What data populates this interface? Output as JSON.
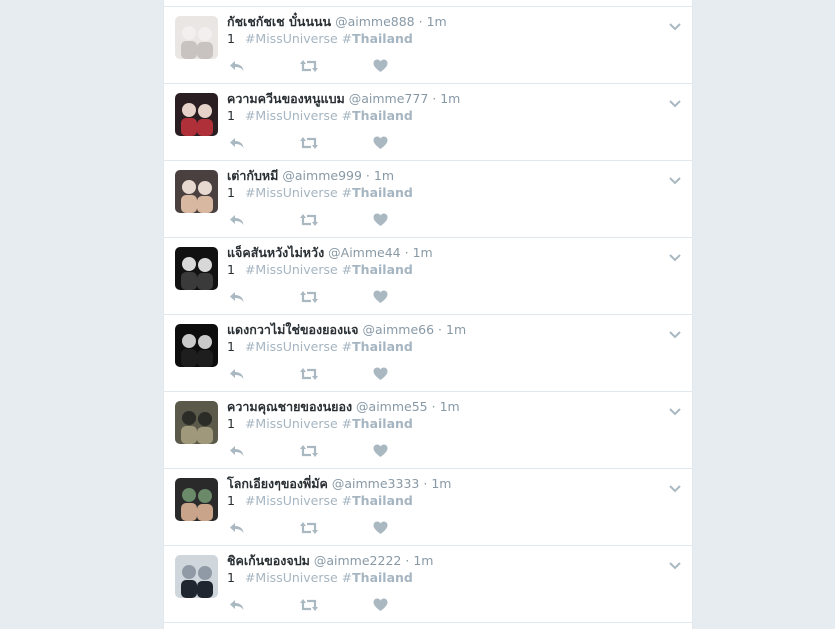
{
  "colors": {
    "page_background": "#e6ecf0",
    "card_background": "#ffffff",
    "hashtag": "#a5b5c1",
    "muted": "#8899a6",
    "action_icon": "#aab8c2",
    "text": "#292f33"
  },
  "tweets": [
    {
      "name": "กัชเชกัชเช บั๋นนนน",
      "handle": "@aimme888",
      "sep": "·",
      "time": "1m",
      "number": "1",
      "tags": [
        {
          "hash": "#",
          "word": "MissUniverse"
        },
        {
          "hash": "#",
          "word": "Thailand"
        }
      ],
      "avatar_colors": [
        "#e9e6e4",
        "#c8c2c0",
        "#f2efee"
      ]
    },
    {
      "name": "ความควีนของหนูแบม",
      "handle": "@aimme777",
      "sep": "·",
      "time": "1m",
      "number": "1",
      "tags": [
        {
          "hash": "#",
          "word": "MissUniverse"
        },
        {
          "hash": "#",
          "word": "Thailand"
        }
      ],
      "avatar_colors": [
        "#2a1e22",
        "#b0303a",
        "#e6d2c8"
      ]
    },
    {
      "name": "เต่ากับหมี",
      "handle": "@aimme999",
      "sep": "·",
      "time": "1m",
      "number": "1",
      "tags": [
        {
          "hash": "#",
          "word": "MissUniverse"
        },
        {
          "hash": "#",
          "word": "Thailand"
        }
      ],
      "avatar_colors": [
        "#4a4040",
        "#d9b8a2",
        "#e8d9d0"
      ]
    },
    {
      "name": "แจ็คสันหวังไม่หวัง",
      "handle": "@Aimme44",
      "sep": "·",
      "time": "1m",
      "number": "1",
      "tags": [
        {
          "hash": "#",
          "word": "MissUniverse"
        },
        {
          "hash": "#",
          "word": "Thailand"
        }
      ],
      "avatar_colors": [
        "#111111",
        "#3a3a3a",
        "#d8d8d8"
      ]
    },
    {
      "name": "แดงกวาไม่ใช่ของยองแจ",
      "handle": "@aimme66",
      "sep": "·",
      "time": "1m",
      "number": "1",
      "tags": [
        {
          "hash": "#",
          "word": "MissUniverse"
        },
        {
          "hash": "#",
          "word": "Thailand"
        }
      ],
      "avatar_colors": [
        "#0d0d0d",
        "#1e1e1e",
        "#c9c9c9"
      ]
    },
    {
      "name": "ความคุณชายของนยอง",
      "handle": "@aimme55",
      "sep": "·",
      "time": "1m",
      "number": "1",
      "tags": [
        {
          "hash": "#",
          "word": "MissUniverse"
        },
        {
          "hash": "#",
          "word": "Thailand"
        }
      ],
      "avatar_colors": [
        "#5b5a4a",
        "#a0987a",
        "#2b2b28"
      ]
    },
    {
      "name": "โลกเอียงๆของพี่มัค",
      "handle": "@aimme3333",
      "sep": "·",
      "time": "1m",
      "number": "1",
      "tags": [
        {
          "hash": "#",
          "word": "MissUniverse"
        },
        {
          "hash": "#",
          "word": "Thailand"
        }
      ],
      "avatar_colors": [
        "#2a2a2a",
        "#c9a48a",
        "#6a8a6a"
      ]
    },
    {
      "name": "ชิคเก้นของจปม",
      "handle": "@aimme2222",
      "sep": "·",
      "time": "1m",
      "number": "1",
      "tags": [
        {
          "hash": "#",
          "word": "MissUniverse"
        },
        {
          "hash": "#",
          "word": "Thailand"
        }
      ],
      "avatar_colors": [
        "#cfd6dc",
        "#1f2630",
        "#8f9aa6"
      ]
    }
  ],
  "icons": {
    "reply": "reply-icon",
    "retweet": "retweet-icon",
    "like": "heart-icon",
    "caret": "chevron-down-icon"
  }
}
